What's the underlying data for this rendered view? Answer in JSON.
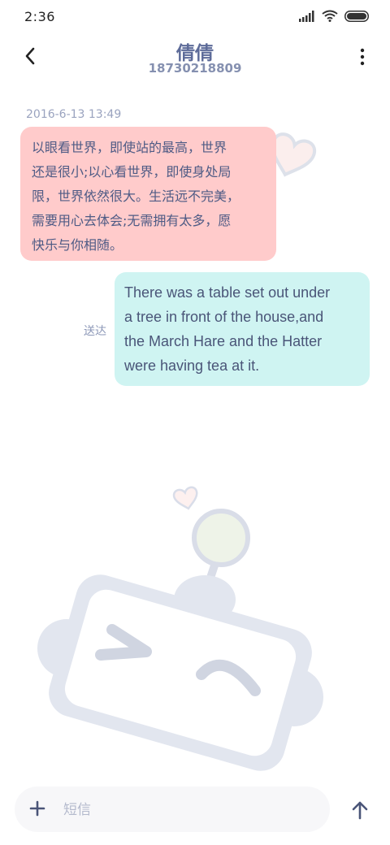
{
  "status_bar": {
    "time": "2:36",
    "icons": [
      "signal-icon",
      "wifi-icon",
      "battery-icon"
    ]
  },
  "header": {
    "contact_name": "倩倩",
    "contact_number": "18730218809"
  },
  "messages": [
    {
      "direction": "incoming",
      "timestamp": "2016-6-13 13:49",
      "lines": [
        "以眼看世界，即使站的最高，世界",
        "还是很小;以心看世界，即使身处局",
        "限，世界依然很大。生活远不完美，",
        "需要用心去体会;无需拥有太多，愿",
        "快乐与你相随。"
      ]
    },
    {
      "direction": "outgoing",
      "status": "送达",
      "lines": [
        "There was a table set out under",
        "a tree in front of the house,and",
        "the March Hare and the Hatter",
        "were having tea at it."
      ]
    }
  ],
  "composer": {
    "placeholder": "短信",
    "value": ""
  },
  "colors": {
    "incoming_bubble": "#ffcbcb",
    "outgoing_bubble": "#cff4f2",
    "text": "#4a5578",
    "accent": "#5d6b99"
  }
}
